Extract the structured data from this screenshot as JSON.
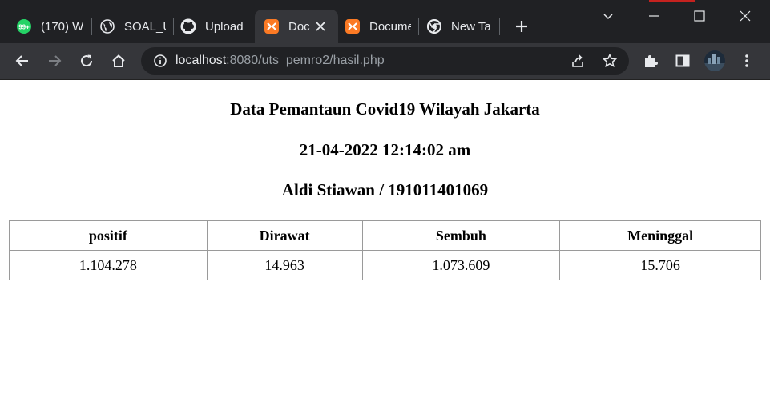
{
  "browser": {
    "tabs": [
      {
        "title": "(170) W",
        "icon": "whatsapp-icon",
        "badge": "99+"
      },
      {
        "title": "SOAL_U",
        "icon": "globe-icon"
      },
      {
        "title": "Upload",
        "icon": "github-icon"
      },
      {
        "title": "Doc",
        "icon": "xampp-icon",
        "active": true
      },
      {
        "title": "Docume",
        "icon": "xampp-icon"
      },
      {
        "title": "New Tab",
        "icon": "chrome-icon"
      }
    ],
    "url_host": "localhost",
    "url_rest": ":8080/uts_pemro2/hasil.php",
    "colors": {
      "tabstrip": "#202124",
      "toolbar": "#35363a",
      "omnibox": "#202124"
    }
  },
  "page": {
    "heading": "Data Pemantaun Covid19 Wilayah Jakarta",
    "datetime": "21-04-2022 12:14:02 am",
    "author": "Aldi Stiawan / 191011401069",
    "table": {
      "headers": [
        "positif",
        "Dirawat",
        "Sembuh",
        "Meninggal"
      ],
      "rows": [
        [
          "1.104.278",
          "14.963",
          "1.073.609",
          "15.706"
        ]
      ]
    }
  }
}
